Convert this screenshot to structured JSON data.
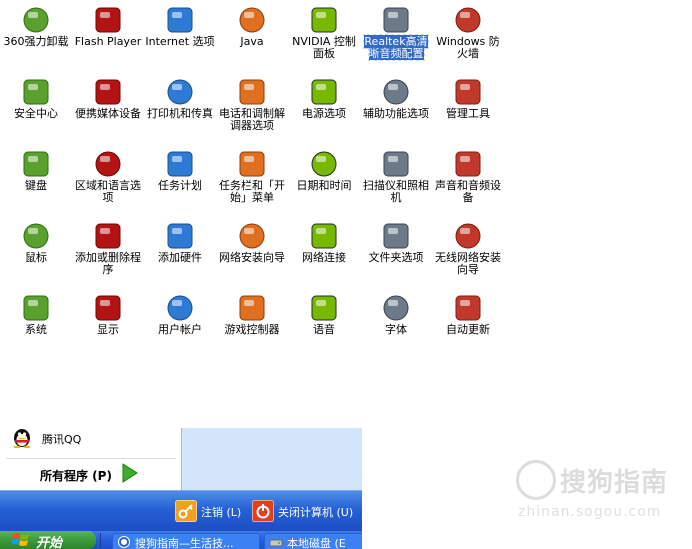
{
  "control_panel": {
    "items": [
      {
        "label": "360强力卸载",
        "icon": "uninstaller-icon"
      },
      {
        "label": "Flash Player",
        "icon": "flash-icon"
      },
      {
        "label": "Internet 选项",
        "icon": "internet-options-icon"
      },
      {
        "label": "Java",
        "icon": "java-icon"
      },
      {
        "label": "NVIDIA 控制面板",
        "icon": "nvidia-icon"
      },
      {
        "label": "Realtek高清晰音频配置",
        "icon": "speaker-icon",
        "selected": true
      },
      {
        "label": "Windows 防火墙",
        "icon": "firewall-icon"
      },
      {
        "label": "安全中心",
        "icon": "shield-icon"
      },
      {
        "label": "便携媒体设备",
        "icon": "media-device-icon"
      },
      {
        "label": "打印机和传真",
        "icon": "printer-icon"
      },
      {
        "label": "电话和调制解调器选项",
        "icon": "phone-modem-icon"
      },
      {
        "label": "电源选项",
        "icon": "power-icon"
      },
      {
        "label": "辅助功能选项",
        "icon": "accessibility-icon"
      },
      {
        "label": "管理工具",
        "icon": "admin-tools-icon"
      },
      {
        "label": "键盘",
        "icon": "keyboard-icon"
      },
      {
        "label": "区域和语言选项",
        "icon": "globe-icon"
      },
      {
        "label": "任务计划",
        "icon": "scheduled-tasks-icon"
      },
      {
        "label": "任务栏和「开始」菜单",
        "icon": "taskbar-icon"
      },
      {
        "label": "日期和时间",
        "icon": "clock-icon"
      },
      {
        "label": "扫描仪和照相机",
        "icon": "scanner-icon"
      },
      {
        "label": "声音和音频设备",
        "icon": "sound-icon"
      },
      {
        "label": "鼠标",
        "icon": "mouse-icon"
      },
      {
        "label": "添加或删除程序",
        "icon": "add-remove-icon"
      },
      {
        "label": "添加硬件",
        "icon": "add-hardware-icon"
      },
      {
        "label": "网络安装向导",
        "icon": "network-setup-icon"
      },
      {
        "label": "网络连接",
        "icon": "network-connections-icon"
      },
      {
        "label": "文件夹选项",
        "icon": "folder-options-icon"
      },
      {
        "label": "无线网络安装向导",
        "icon": "wireless-icon"
      },
      {
        "label": "系统",
        "icon": "system-icon"
      },
      {
        "label": "显示",
        "icon": "display-icon"
      },
      {
        "label": "用户帐户",
        "icon": "user-accounts-icon"
      },
      {
        "label": "游戏控制器",
        "icon": "game-controller-icon"
      },
      {
        "label": "语音",
        "icon": "speech-icon"
      },
      {
        "label": "字体",
        "icon": "fonts-icon"
      },
      {
        "label": "自动更新",
        "icon": "windows-update-icon"
      }
    ]
  },
  "start_menu": {
    "qq_label": "腾讯QQ",
    "all_programs": "所有程序 (P)",
    "logoff": "注销 (L)",
    "shutdown": "关闭计算机 (U)"
  },
  "taskbar": {
    "start": "开始",
    "tasks": [
      {
        "label": "搜狗指南—生活技...",
        "icon": "sogou-icon"
      },
      {
        "label": "本地磁盘 (E",
        "icon": "drive-icon"
      }
    ]
  },
  "watermark": {
    "title": "搜狗指南",
    "subtitle": "zhinan.sogou.com"
  },
  "colors": {
    "selection": "#316ac5",
    "start_green": "#3c9a3c",
    "taskbar_blue": "#245edb"
  }
}
